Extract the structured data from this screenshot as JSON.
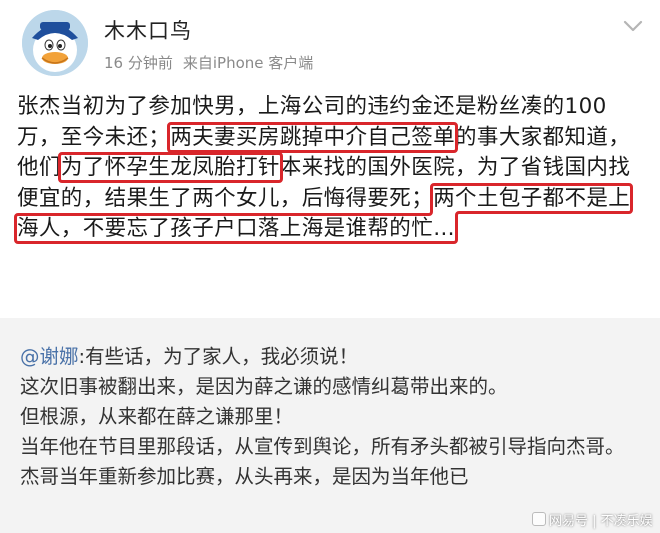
{
  "post": {
    "author": "木木口鸟",
    "time": "16 分钟前",
    "source": "来自iPhone 客户端",
    "content": {
      "seg1": "张杰当初为了参加快男，上海公司的违约金还是粉丝凑的100万，至今未还；",
      "hl1": "两夫妻买房跳掉中介自己签单",
      "seg2": "的事大家都知道，他们",
      "hl2": "为了怀孕生龙凤胎打针",
      "seg3": "本来找的国外医院，为了省钱国内找便宜的，结果生了两个女儿，后悔得要死；",
      "hl3": "两个土包子都不是上海人，不要忘了孩子户口落上海是谁帮的忙…"
    },
    "highlight_color": "#d9262b"
  },
  "repost": {
    "mention": "@谢娜",
    "lines": [
      ":有些话，为了家人，我必须说！",
      "这次旧事被翻出来，是因为薛之谦的感情纠葛带出来的。",
      "但根源，从来都在薛之谦那里！",
      "当年他在节目里那段话，从宣传到舆论，所有矛头都被引导指向杰哥。",
      "杰哥当年重新参加比赛，从头再来，是因为当年他已"
    ],
    "mention_color": "#4a72a8"
  },
  "watermark": {
    "text": "网易号 | 不凑乐娱"
  },
  "icons": {
    "avatar": "donald-duck-avatar",
    "menu": "chevron-down-icon"
  }
}
